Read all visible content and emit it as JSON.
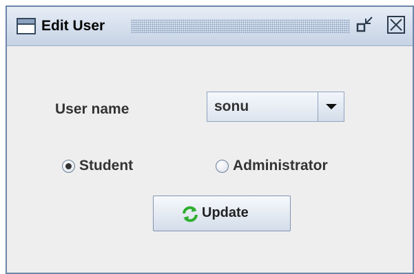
{
  "window": {
    "title": "Edit User",
    "icons": {
      "app": "window-icon",
      "restore": "restore-icon",
      "close": "close-icon"
    }
  },
  "form": {
    "username_label": "User name",
    "username_value": "sonu",
    "role_options": [
      {
        "label": "Student",
        "selected": true
      },
      {
        "label": "Administrator",
        "selected": false
      }
    ],
    "update_button_label": "Update",
    "update_icon": "refresh-icon"
  },
  "colors": {
    "frame_border": "#6b85a8",
    "background": "#eeeeee",
    "refresh_icon": "#2fae2f"
  }
}
